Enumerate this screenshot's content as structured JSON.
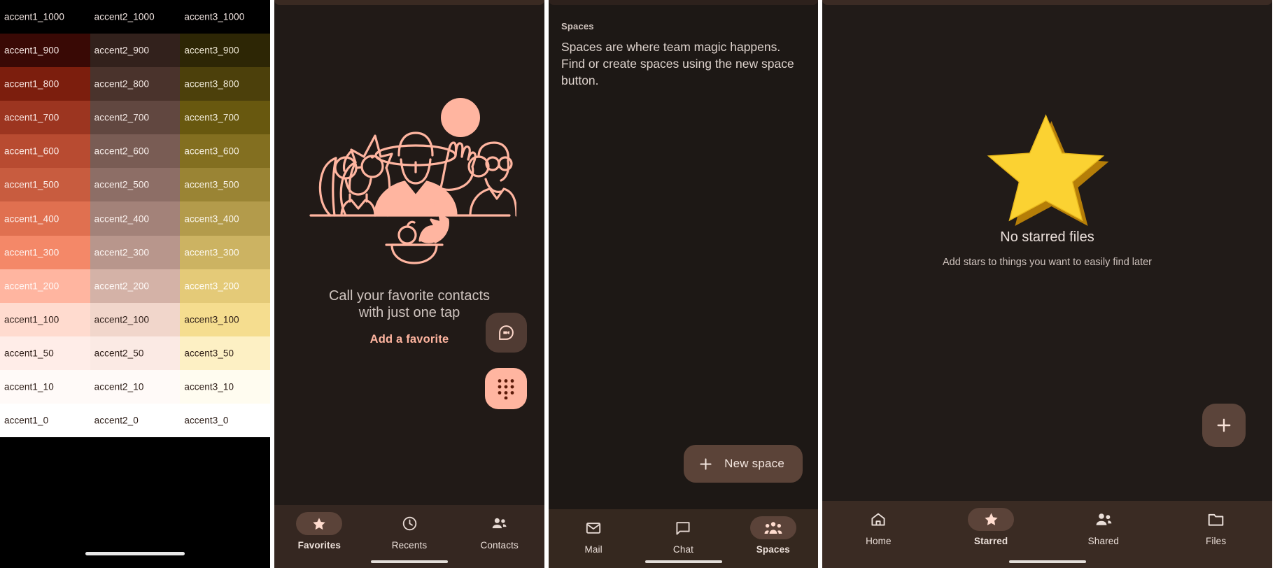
{
  "palette": {
    "columns": [
      "accent1",
      "accent2",
      "accent3"
    ],
    "tones": [
      "1000",
      "900",
      "800",
      "700",
      "600",
      "500",
      "400",
      "300",
      "200",
      "100",
      "50",
      "10",
      "0"
    ],
    "rows": [
      {
        "tone": "1000",
        "cells": [
          {
            "label": "accent1_1000",
            "bg": "#000000",
            "fg": "#f5e8e4"
          },
          {
            "label": "accent2_1000",
            "bg": "#000000",
            "fg": "#f5e8e4"
          },
          {
            "label": "accent3_1000",
            "bg": "#000000",
            "fg": "#f5e8e4"
          }
        ]
      },
      {
        "tone": "900",
        "cells": [
          {
            "label": "accent1_900",
            "bg": "#390905",
            "fg": "#f7e9e5"
          },
          {
            "label": "accent2_900",
            "bg": "#32211c",
            "fg": "#f3e7e3"
          },
          {
            "label": "accent3_900",
            "bg": "#2d2605",
            "fg": "#f3ecd9"
          }
        ]
      },
      {
        "tone": "800",
        "cells": [
          {
            "label": "accent1_800",
            "bg": "#7c1e0d",
            "fg": "#fbe9e5"
          },
          {
            "label": "accent2_800",
            "bg": "#4a332c",
            "fg": "#f4e9e5"
          },
          {
            "label": "accent3_800",
            "bg": "#4c400b",
            "fg": "#f3eedd"
          }
        ]
      },
      {
        "tone": "700",
        "cells": [
          {
            "label": "accent1_700",
            "bg": "#9c3520",
            "fg": "#fceae6"
          },
          {
            "label": "accent2_700",
            "bg": "#614740",
            "fg": "#f6ebe7"
          },
          {
            "label": "accent3_700",
            "bg": "#68580f",
            "fg": "#f5f0e0"
          }
        ]
      },
      {
        "tone": "600",
        "cells": [
          {
            "label": "accent1_600",
            "bg": "#b84b31",
            "fg": "#fdeee9"
          },
          {
            "label": "accent2_600",
            "bg": "#795c54",
            "fg": "#f8eeea"
          },
          {
            "label": "accent3_600",
            "bg": "#836f20",
            "fg": "#f7f2e4"
          }
        ]
      },
      {
        "tone": "500",
        "cells": [
          {
            "label": "accent1_500",
            "bg": "#c85c3f",
            "fg": "#fdf0ec"
          },
          {
            "label": "accent2_500",
            "bg": "#8d6e66",
            "fg": "#faf0ed"
          },
          {
            "label": "accent3_500",
            "bg": "#9a8434",
            "fg": "#f9f4e8"
          }
        ]
      },
      {
        "tone": "400",
        "cells": [
          {
            "label": "accent1_400",
            "bg": "#e07050",
            "fg": "#fdf2ef"
          },
          {
            "label": "accent2_400",
            "bg": "#a38279",
            "fg": "#fcf3f0"
          },
          {
            "label": "accent3_400",
            "bg": "#b39b4b",
            "fg": "#fbf7ec"
          }
        ]
      },
      {
        "tone": "300",
        "cells": [
          {
            "label": "accent1_300",
            "bg": "#f48868",
            "fg": "#fef5f2"
          },
          {
            "label": "accent2_300",
            "bg": "#b8968c",
            "fg": "#fdf6f3"
          },
          {
            "label": "accent3_300",
            "bg": "#ccb362",
            "fg": "#fdfaf1"
          }
        ]
      },
      {
        "tone": "200",
        "cells": [
          {
            "label": "accent1_200",
            "bg": "#ffb5a0",
            "fg": "#fff8f6"
          },
          {
            "label": "accent2_200",
            "bg": "#d4b2a7",
            "fg": "#fffaf8"
          },
          {
            "label": "accent3_200",
            "bg": "#e4ca78",
            "fg": "#fffdf6"
          }
        ]
      },
      {
        "tone": "100",
        "cells": [
          {
            "label": "accent1_100",
            "bg": "#ffdbcf",
            "fg": "#2a1a14"
          },
          {
            "label": "accent2_100",
            "bg": "#f1d6cb",
            "fg": "#2a1a14"
          },
          {
            "label": "accent3_100",
            "bg": "#f5dd8f",
            "fg": "#2a1a14"
          }
        ]
      },
      {
        "tone": "50",
        "cells": [
          {
            "label": "accent1_50",
            "bg": "#ffede8",
            "fg": "#2a1a14"
          },
          {
            "label": "accent2_50",
            "bg": "#fbeae4",
            "fg": "#2a1a14"
          },
          {
            "label": "accent3_50",
            "bg": "#fdf0c4",
            "fg": "#2a1a14"
          }
        ]
      },
      {
        "tone": "10",
        "cells": [
          {
            "label": "accent1_10",
            "bg": "#fffaf8",
            "fg": "#2a1a14"
          },
          {
            "label": "accent2_10",
            "bg": "#fffaf8",
            "fg": "#2a1a14"
          },
          {
            "label": "accent3_10",
            "bg": "#fffcf0",
            "fg": "#2a1a14"
          }
        ]
      },
      {
        "tone": "0",
        "cells": [
          {
            "label": "accent1_0",
            "bg": "#ffffff",
            "fg": "#2a1a14"
          },
          {
            "label": "accent2_0",
            "bg": "#ffffff",
            "fg": "#2a1a14"
          },
          {
            "label": "accent3_0",
            "bg": "#ffffff",
            "fg": "#2a1a14"
          }
        ]
      }
    ]
  },
  "phone_app": {
    "empty_state": {
      "title_line1": "Call your favorite contacts",
      "title_line2": "with just one tap",
      "action_link": "Add a favorite"
    },
    "fabs": [
      {
        "name": "video-call-fab",
        "icon": "video-call-icon",
        "bg": "#503b33",
        "fg": "#ffd9cc"
      },
      {
        "name": "dialpad-fab",
        "icon": "dialpad-icon",
        "bg": "#ffb5a0",
        "fg": "#5c1a08"
      }
    ],
    "bottom_nav": [
      {
        "label": "Favorites",
        "icon": "star-icon",
        "selected": true
      },
      {
        "label": "Recents",
        "icon": "clock-icon",
        "selected": false
      },
      {
        "label": "Contacts",
        "icon": "contacts-icon",
        "selected": false
      }
    ]
  },
  "chat_app": {
    "section_label": "Spaces",
    "description": "Spaces are where team magic happens. Find or create spaces using the new space button.",
    "new_space_button": {
      "label": "New space",
      "icon": "plus-icon"
    },
    "bottom_nav": [
      {
        "label": "Mail",
        "icon": "mail-icon",
        "selected": false
      },
      {
        "label": "Chat",
        "icon": "chat-bubble-icon",
        "selected": false
      },
      {
        "label": "Spaces",
        "icon": "people-group-icon",
        "selected": true
      }
    ]
  },
  "drive_app": {
    "empty_state": {
      "illustration": "gold-star-illustration",
      "title": "No starred files",
      "subtitle": "Add stars to things you want to easily find later"
    },
    "fab": {
      "name": "create-fab",
      "icon": "plus-icon",
      "bg": "#5b443a"
    },
    "bottom_nav": [
      {
        "label": "Home",
        "icon": "home-icon",
        "selected": false
      },
      {
        "label": "Starred",
        "icon": "star-icon",
        "selected": true
      },
      {
        "label": "Shared",
        "icon": "shared-people-icon",
        "selected": false
      },
      {
        "label": "Files",
        "icon": "folder-icon",
        "selected": false
      }
    ]
  },
  "theme": {
    "accent_primary": "#ffb5a0",
    "surface_dark": "#211a17",
    "nav_surface": "#352721",
    "selected_pill": "#5b4339",
    "star_gold": "#fbd232",
    "star_gold_shadow": "#c0890a"
  }
}
